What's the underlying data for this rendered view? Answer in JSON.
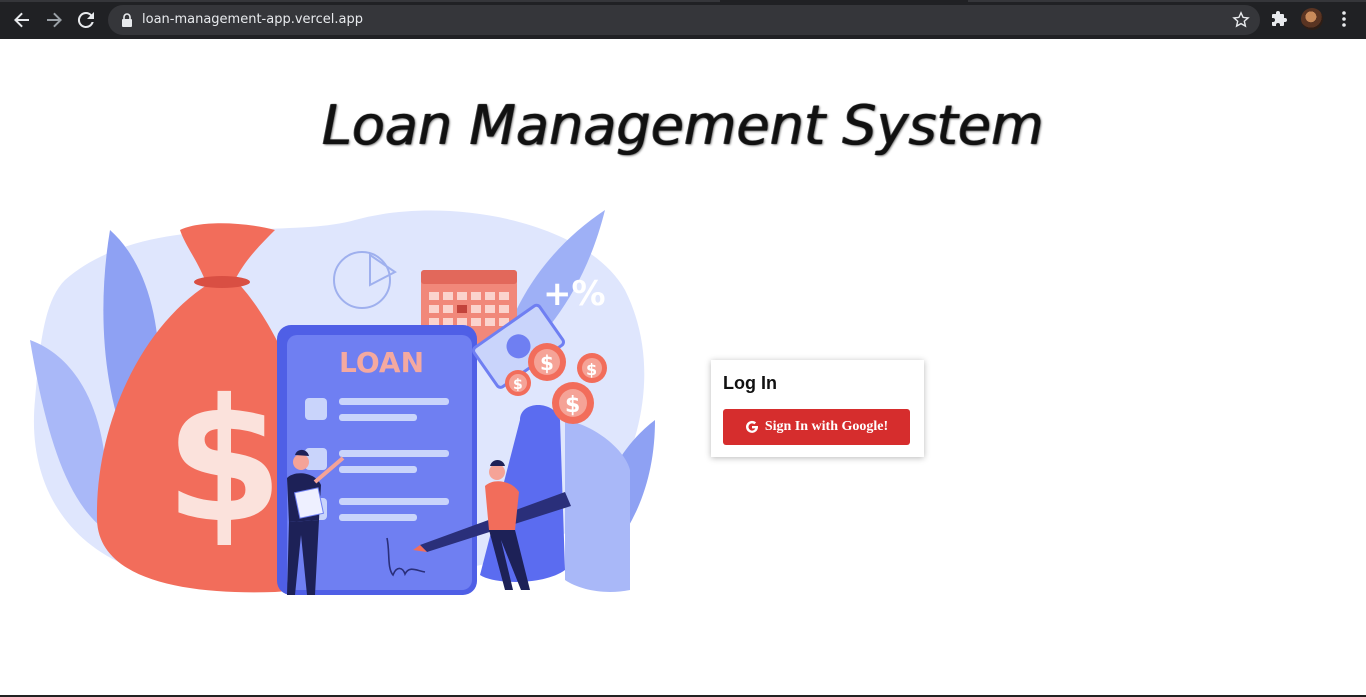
{
  "browser": {
    "url": "loan-management-app.vercel.app",
    "icons": [
      "back-icon",
      "forward-icon",
      "reload-icon",
      "lock-icon",
      "bookmark-star-icon",
      "extensions-icon",
      "profile-avatar",
      "menu-icon"
    ]
  },
  "page": {
    "title": "Loan Management System",
    "hero": {
      "doc_label": "LOAN",
      "percent_label": "+%",
      "dollar_glyph": "$",
      "coin_glyph": "$"
    },
    "login": {
      "heading": "Log In",
      "google_button": "Sign In with Google!"
    }
  },
  "colors": {
    "chrome_bg": "#202124",
    "omnibox_bg": "#35363a",
    "button_red": "#d62d2d",
    "illustration_red": "#f26d5b",
    "illustration_blue": "#5b6cf0",
    "illustration_light_blue": "#c9d4fb"
  }
}
